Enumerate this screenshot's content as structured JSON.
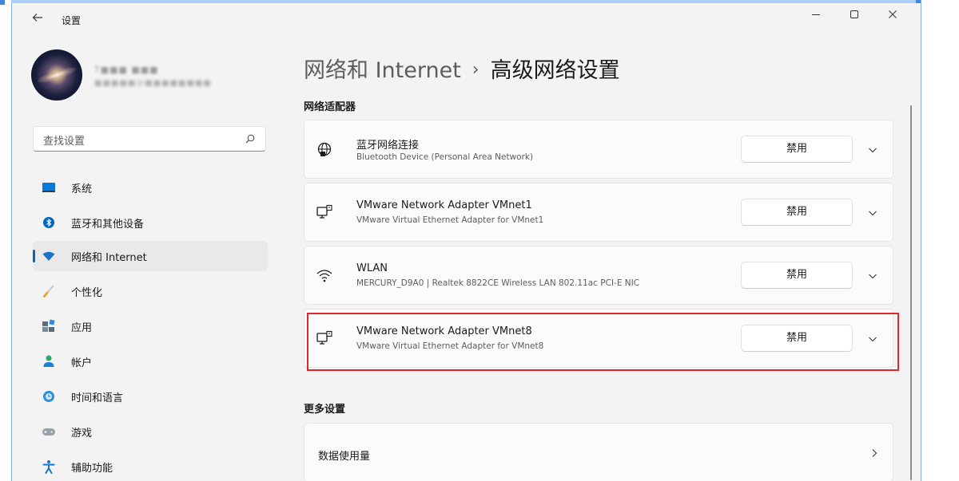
{
  "window": {
    "title": "设置",
    "controls": [
      "minimize-icon",
      "maximize-icon",
      "close-icon"
    ]
  },
  "user": {
    "name": "T■■■ ■■■",
    "email": "■■■■■@■■■■■■■■"
  },
  "search": {
    "placeholder": "查找设置",
    "icon": "search-icon"
  },
  "sidebar": {
    "active_index": 2,
    "items": [
      {
        "label": "系统",
        "icon": "system-icon",
        "color": "#0078d4"
      },
      {
        "label": "蓝牙和其他设备",
        "icon": "bluetooth-icon",
        "color": "#0067c0"
      },
      {
        "label": "网络和 Internet",
        "icon": "wifi-icon",
        "color": "#1a73c8"
      },
      {
        "label": "个性化",
        "icon": "brush-icon",
        "color": "#e7a33e"
      },
      {
        "label": "应用",
        "icon": "apps-icon",
        "color": "#5a6b7b"
      },
      {
        "label": "帐户",
        "icon": "account-icon",
        "color": "#2ea26f"
      },
      {
        "label": "时间和语言",
        "icon": "clock-globe-icon",
        "color": "#2f8fd9"
      },
      {
        "label": "游戏",
        "icon": "gamepad-icon",
        "color": "#8a8f98"
      },
      {
        "label": "辅助功能",
        "icon": "accessibility-icon",
        "color": "#1a73c8"
      }
    ]
  },
  "breadcrumb": {
    "parent": "网络和 Internet",
    "separator": "›",
    "current": "高级网络设置"
  },
  "adapters": {
    "heading": "网络适配器",
    "items": [
      {
        "title": "蓝牙网络连接",
        "subtitle": "Bluetooth Device (Personal Area Network)",
        "button": "禁用",
        "icon": "globe-network-icon"
      },
      {
        "title": "VMware Network Adapter VMnet1",
        "subtitle": "VMware Virtual Ethernet Adapter for VMnet1",
        "button": "禁用",
        "icon": "ethernet-monitor-icon"
      },
      {
        "title": "WLAN",
        "subtitle": "MERCURY_D9A0 | Realtek 8822CE Wireless LAN 802.11ac PCI-E NIC",
        "button": "禁用",
        "icon": "wifi-icon"
      },
      {
        "title": "VMware Network Adapter VMnet8",
        "subtitle": "VMware Virtual Ethernet Adapter for VMnet8",
        "button": "禁用",
        "icon": "ethernet-monitor-icon",
        "highlighted": true
      }
    ]
  },
  "more_settings": {
    "heading": "更多设置",
    "items": [
      {
        "label": "数据使用量",
        "icon": "chevron-right-icon"
      }
    ]
  },
  "colors": {
    "accent": "#0067c0",
    "highlight_border": "#e0262a",
    "window_bg": "#f3f3f3",
    "card_bg": "#fbfbfb"
  }
}
